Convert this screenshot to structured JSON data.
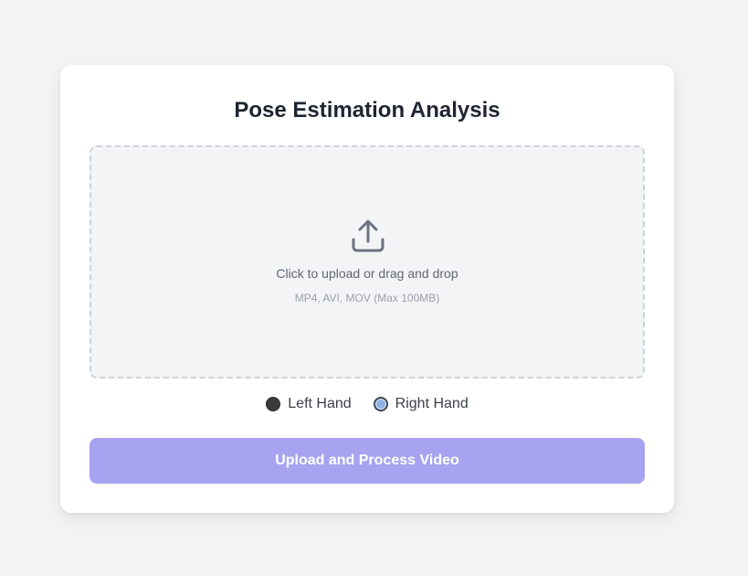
{
  "card": {
    "title": "Pose Estimation Analysis"
  },
  "upload": {
    "icon": "upload-icon",
    "prompt": "Click to upload or drag and drop",
    "hint": "MP4, AVI, MOV (Max 100MB)"
  },
  "hand_selection": {
    "options": [
      {
        "label": "Left Hand",
        "selected": false
      },
      {
        "label": "Right Hand",
        "selected": true
      }
    ]
  },
  "actions": {
    "submit_label": "Upload and Process Video"
  },
  "colors": {
    "background": "#f2f3f5",
    "card": "#ffffff",
    "button": "#a7a3f0",
    "title": "#1e2431"
  }
}
